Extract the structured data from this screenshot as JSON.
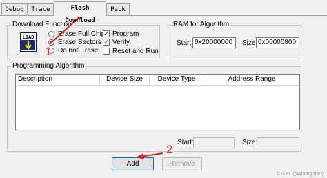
{
  "tabs": [
    {
      "label": "Debug",
      "active": false
    },
    {
      "label": "Trace",
      "active": false
    },
    {
      "label": "Flash Download",
      "active": true
    },
    {
      "label": "Pack",
      "active": false
    }
  ],
  "download_function": {
    "title": "Download Function",
    "load_icon_text": "LOAD",
    "radios": [
      {
        "label": "Erase Full Chip",
        "selected": false
      },
      {
        "label": "Erase Sectors",
        "selected": true
      },
      {
        "label": "Do not Erase",
        "selected": false
      }
    ],
    "checks": [
      {
        "label": "Program",
        "checked": true
      },
      {
        "label": "Verify",
        "checked": true
      },
      {
        "label": "Reset and Run",
        "checked": false
      }
    ]
  },
  "ram": {
    "title": "RAM for Algorithm",
    "start_label": "Start:",
    "start_value": "0x20000000",
    "size_label": "Size:",
    "size_value": "0x00000800"
  },
  "programming": {
    "title": "Programming Algorithm",
    "columns": [
      "Description",
      "Device Size",
      "Device Type",
      "Address Range"
    ],
    "start_label": "Start:",
    "start_value": "",
    "size_label": "Size:",
    "size_value": ""
  },
  "buttons": {
    "add": "Add",
    "remove": "Remove"
  },
  "annotations": {
    "one": "1",
    "two": "2",
    "color": "#e02020"
  },
  "watermark": "CSDN @Whongmeng"
}
